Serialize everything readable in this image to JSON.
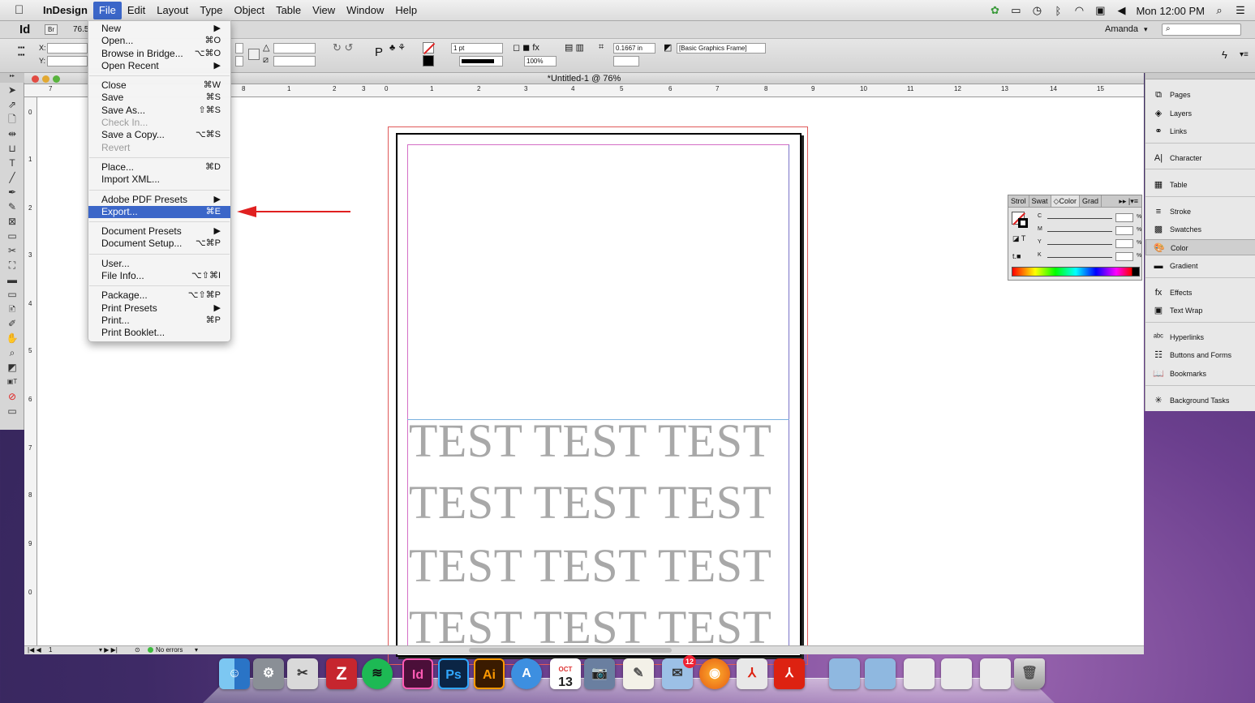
{
  "menubar": {
    "app_name": "InDesign",
    "items": [
      "File",
      "Edit",
      "Layout",
      "Type",
      "Object",
      "Table",
      "View",
      "Window",
      "Help"
    ],
    "clock": "Mon 12:00 PM"
  },
  "appbar": {
    "logo": "Id",
    "bridge": "Br",
    "zoom": "76.5",
    "user": "Amanda",
    "search_placeholder": ""
  },
  "controlbar": {
    "x_label": "X:",
    "y_label": "Y:",
    "stroke_weight": "1 pt",
    "scale": "100%",
    "offset": "0.1667 in",
    "object_style": "[Basic Graphics Frame]"
  },
  "document": {
    "title": "*Untitled-1 @ 76%",
    "ruler_h": [
      "7",
      "8",
      "1",
      "2",
      "3",
      "0",
      "1",
      "2",
      "3",
      "4",
      "5",
      "6",
      "7",
      "8",
      "9",
      "10",
      "11",
      "12",
      "13",
      "14",
      "15"
    ],
    "ruler_v": [
      "0",
      "1",
      "2",
      "3",
      "4",
      "5",
      "6",
      "7",
      "8",
      "9",
      "0"
    ],
    "test_lines": [
      "TEST TEST TEST",
      "TEST TEST TEST",
      "TEST TEST TEST",
      "TEST TEST TEST"
    ],
    "page_number": "1",
    "preflight": "No errors"
  },
  "file_menu": {
    "groups": [
      [
        {
          "label": "New",
          "shortcut": "▶",
          "enabled": true
        },
        {
          "label": "Open...",
          "shortcut": "⌘O",
          "enabled": true
        },
        {
          "label": "Browse in Bridge...",
          "shortcut": "⌥⌘O",
          "enabled": true
        },
        {
          "label": "Open Recent",
          "shortcut": "▶",
          "enabled": true
        }
      ],
      [
        {
          "label": "Close",
          "shortcut": "⌘W",
          "enabled": true
        },
        {
          "label": "Save",
          "shortcut": "⌘S",
          "enabled": true
        },
        {
          "label": "Save As...",
          "shortcut": "⇧⌘S",
          "enabled": true
        },
        {
          "label": "Check In...",
          "shortcut": "",
          "enabled": false
        },
        {
          "label": "Save a Copy...",
          "shortcut": "⌥⌘S",
          "enabled": true
        },
        {
          "label": "Revert",
          "shortcut": "",
          "enabled": false
        }
      ],
      [
        {
          "label": "Place...",
          "shortcut": "⌘D",
          "enabled": true
        },
        {
          "label": "Import XML...",
          "shortcut": "",
          "enabled": true
        }
      ],
      [
        {
          "label": "Adobe PDF Presets",
          "shortcut": "▶",
          "enabled": true
        },
        {
          "label": "Export...",
          "shortcut": "⌘E",
          "enabled": true,
          "selected": true
        }
      ],
      [
        {
          "label": "Document Presets",
          "shortcut": "▶",
          "enabled": true
        },
        {
          "label": "Document Setup...",
          "shortcut": "⌥⌘P",
          "enabled": true
        }
      ],
      [
        {
          "label": "User...",
          "shortcut": "",
          "enabled": true
        },
        {
          "label": "File Info...",
          "shortcut": "⌥⇧⌘I",
          "enabled": true
        }
      ],
      [
        {
          "label": "Package...",
          "shortcut": "⌥⇧⌘P",
          "enabled": true
        },
        {
          "label": "Print Presets",
          "shortcut": "▶",
          "enabled": true
        },
        {
          "label": "Print...",
          "shortcut": "⌘P",
          "enabled": true
        },
        {
          "label": "Print Booklet...",
          "shortcut": "",
          "enabled": true
        }
      ]
    ]
  },
  "color_panel": {
    "tabs": [
      "Strol",
      "Swat",
      "◇Color",
      "Grad"
    ],
    "channels": [
      "C",
      "M",
      "Y",
      "K"
    ],
    "unit": "%"
  },
  "panels": {
    "items": [
      "Pages",
      "Layers",
      "Links",
      "Character",
      "Table",
      "Stroke",
      "Swatches",
      "Color",
      "Gradient",
      "Effects",
      "Text Wrap",
      "Hyperlinks",
      "Buttons and Forms",
      "Bookmarks",
      "Background Tasks"
    ]
  },
  "dock": {
    "items": [
      "Finder",
      "System Preferences",
      "Grab",
      "FileZilla",
      "Spotify",
      "InDesign",
      "Photoshop",
      "Illustrator",
      "App Store",
      "Calendar",
      "Image Capture",
      "TextEdit",
      "Mail",
      "Firefox",
      "Acrobat",
      "Acrobat Reader",
      "Folder",
      "Folder",
      "Documents",
      "Downloads",
      "Trash"
    ],
    "calendar_day": "13",
    "calendar_month": "OCT",
    "mail_badge": "12"
  },
  "colors": {
    "menu_highlight": "#3b66c8",
    "arrow": "#e02020",
    "bleed": "#e05a5a",
    "margin": "#d46fc6"
  }
}
